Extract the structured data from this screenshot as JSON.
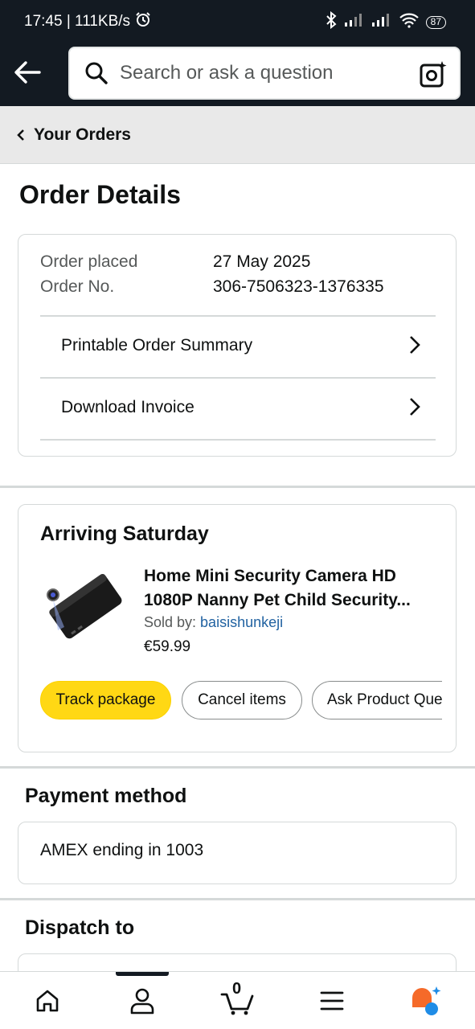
{
  "status_bar": {
    "time_speed": "17:45 | 111KB/s",
    "battery": "87"
  },
  "header": {
    "search_placeholder": "Search or ask a question"
  },
  "breadcrumb": {
    "label": "Your Orders"
  },
  "page_title": "Order Details",
  "order_info": {
    "placed_label": "Order placed",
    "placed_value": "27 May 2025",
    "number_label": "Order No.",
    "number_value": "306-7506323-1376335",
    "links": [
      "Printable Order Summary",
      "Download Invoice"
    ]
  },
  "shipment": {
    "title": "Arriving Saturday",
    "product_title_line1": "Home Mini Security Camera HD",
    "product_title_line2": "1080P Nanny Pet Child Security...",
    "sold_by_label": "Sold by: ",
    "seller": "baisishunkeji",
    "price": "€59.99",
    "buttons": {
      "track": "Track package",
      "cancel": "Cancel items",
      "ask": "Ask Product Question"
    }
  },
  "payment": {
    "title": "Payment method",
    "method": "AMEX  ending in 1003"
  },
  "dispatch": {
    "title": "Dispatch to"
  },
  "bottom_nav": {
    "cart_count": "0",
    "items": [
      "home-icon",
      "account-icon",
      "cart-icon",
      "menu-icon",
      "rufus-icon"
    ]
  },
  "colors": {
    "header_bg": "#131a22",
    "primary_button": "#ffd814",
    "link": "#2162a1",
    "assistant_orange": "#f56a29",
    "assistant_blue": "#1f8ce6"
  }
}
